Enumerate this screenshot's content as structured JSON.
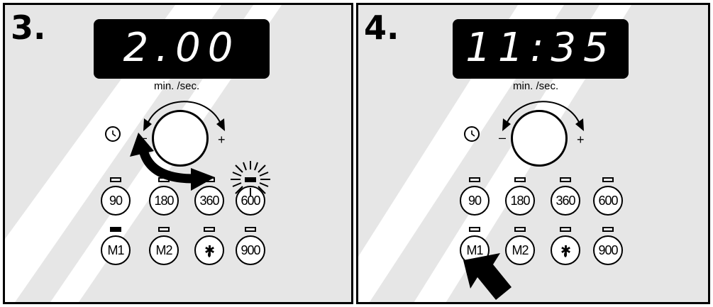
{
  "panels": [
    {
      "step": "3.",
      "display": "2.00",
      "unit_label": "min. /sec.",
      "minus": "–",
      "plus": "+",
      "row1": [
        "90",
        "180",
        "360",
        "600"
      ],
      "row2": [
        "M1",
        "M2",
        "✱",
        "900"
      ]
    },
    {
      "step": "4.",
      "display": "11:35",
      "unit_label": "min. /sec.",
      "minus": "–",
      "plus": "+",
      "row1": [
        "90",
        "180",
        "360",
        "600"
      ],
      "row2": [
        "M1",
        "M2",
        "✱",
        "900"
      ]
    }
  ]
}
